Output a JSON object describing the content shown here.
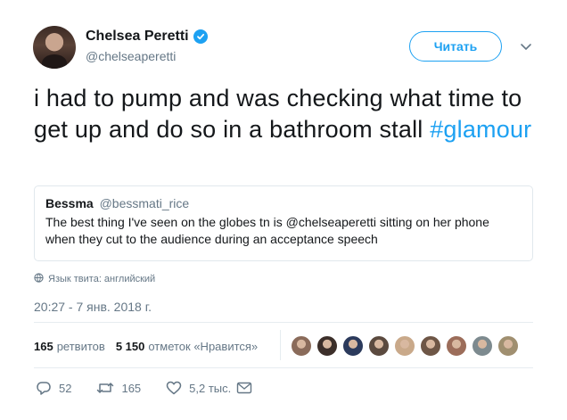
{
  "user": {
    "name": "Chelsea Peretti",
    "handle": "@chelseaperetti",
    "follow_label": "Читать"
  },
  "tweet": {
    "text": "i had to pump and was checking what time to get up and do so in a bathroom stall",
    "hashtag": "#glamour",
    "language_label": "Язык твита: английский",
    "timestamp": "20:27 - 7 янв. 2018 г."
  },
  "quote": {
    "name": "Bessma",
    "handle": "@bessmati_rice",
    "text": "The best thing I've seen on the globes tn is @chelseaperetti sitting on her phone when they cut to the audience during an acceptance speech"
  },
  "stats": {
    "retweets_count": "165",
    "retweets_label": "ретвитов",
    "likes_count": "5 150",
    "likes_label": "отметок «Нравится»"
  },
  "likers": [
    {
      "color": "#8a6b5a"
    },
    {
      "color": "#3c2f2a"
    },
    {
      "color": "#2b3a5c"
    },
    {
      "color": "#5b4a3f"
    },
    {
      "color": "#c9a98a"
    },
    {
      "color": "#6e5646"
    },
    {
      "color": "#9c6d5a"
    },
    {
      "color": "#7d8a8f"
    },
    {
      "color": "#a08f70"
    }
  ],
  "actions": {
    "replies": "52",
    "retweets": "165",
    "likes": "5,2 тыс."
  },
  "colors": {
    "accent": "#1da1f2",
    "muted": "#657786",
    "text": "#14171a",
    "border": "#e1e8ed"
  }
}
